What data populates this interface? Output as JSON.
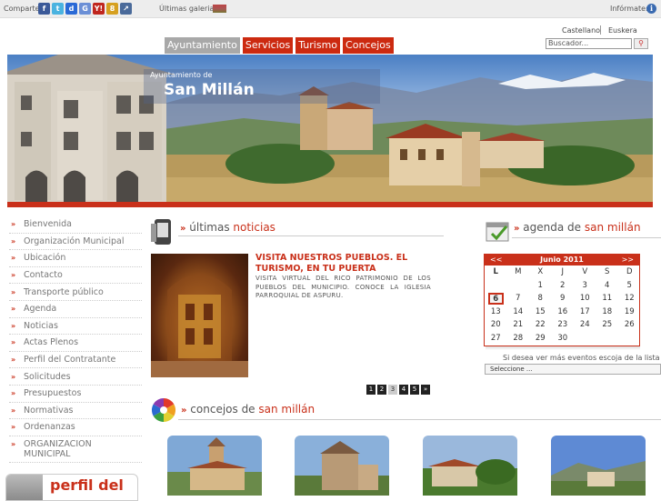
{
  "topbar": {
    "comparte_label": "Comparte:",
    "share_icons": [
      {
        "name": "facebook-icon",
        "glyph": "f",
        "color": "#3b5998"
      },
      {
        "name": "twitter-icon",
        "glyph": "t",
        "color": "#4ab3e0"
      },
      {
        "name": "delicious-icon",
        "glyph": "d",
        "color": "#2a6ad6"
      },
      {
        "name": "google-icon",
        "glyph": "G",
        "color": "#6b8fd6"
      },
      {
        "name": "yahoo-icon",
        "glyph": "Y!",
        "color": "#c0261e"
      },
      {
        "name": "digg-icon",
        "glyph": "8",
        "color": "#d6a020"
      },
      {
        "name": "meneame-icon",
        "glyph": "↗",
        "color": "#4a6a9a"
      }
    ],
    "galerias_label": "Últimas galerias:",
    "informate_label": "Infórmate:"
  },
  "lang": {
    "es": "Castellano",
    "eu": "Euskera"
  },
  "nav": {
    "tabs": [
      "Ayuntamiento",
      "Servicios",
      "Turismo",
      "Concejos"
    ]
  },
  "search": {
    "placeholder": "Buscador..."
  },
  "banner": {
    "subtitle": "Ayuntamiento de",
    "title": "San Millán"
  },
  "sidebar": {
    "items": [
      "Bienvenida",
      "Organización Municipal",
      "Ubicación",
      "Contacto",
      "Transporte público",
      "Agenda",
      "Noticias",
      "Actas Plenos",
      "Perfil del Contratante",
      "Solicitudes",
      "Presupuestos",
      "Normativas",
      "Ordenanzas"
    ],
    "multi_item": [
      "ORGANIZACION",
      "MUNICIPAL"
    ],
    "perfil_text": "perfil del"
  },
  "noticias": {
    "chevrons": "»",
    "title_plain": "últimas",
    "title_hl": "noticias",
    "headline": "VISITA NUESTROS PUEBLOS. EL TURISMO, EN TU PUERTA",
    "body": "VISITA VIRTUAL DEL RICO PATRIMONIO DE LOS PUEBLOS DEL MUNICIPIO. CONOCE LA IGLESIA PARROQUIAL DE ASPURU.",
    "pages": [
      "1",
      "2",
      "3",
      "4",
      "5",
      "»"
    ],
    "current_page": "3"
  },
  "concejos": {
    "chevrons": "»",
    "title_plain": "concejos de",
    "title_hl": "san millán"
  },
  "agenda": {
    "chevrons": "»",
    "title_plain": "agenda de",
    "title_hl": "san millán",
    "prev": "<<",
    "next": ">>",
    "month": "Junio 2011",
    "dow": [
      "L",
      "M",
      "X",
      "J",
      "V",
      "S",
      "D"
    ],
    "days": [
      "",
      "",
      "1",
      "2",
      "3",
      "4",
      "5",
      "6",
      "7",
      "8",
      "9",
      "10",
      "11",
      "12",
      "13",
      "14",
      "15",
      "16",
      "17",
      "18",
      "19",
      "20",
      "21",
      "22",
      "23",
      "24",
      "25",
      "26",
      "27",
      "28",
      "29",
      "30",
      "",
      "",
      ""
    ],
    "today": "6",
    "events_note": "Si desea ver más eventos escoja de la lista",
    "select_value": "Seleccione ..."
  },
  "colors": {
    "accent": "#c9301a",
    "nav_active": "#a8a8a8"
  }
}
